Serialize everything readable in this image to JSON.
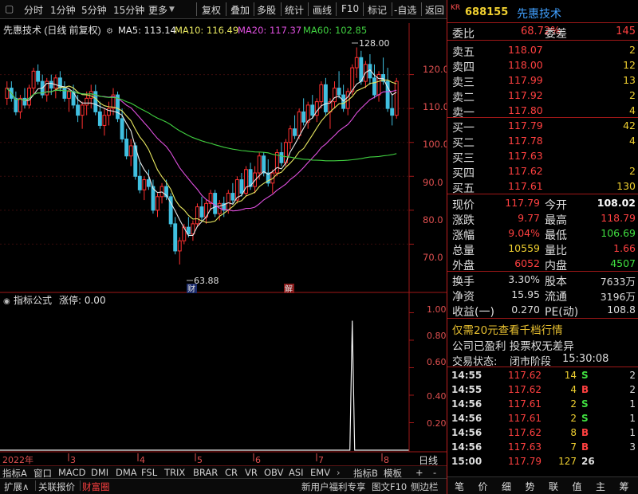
{
  "toolbar": {
    "periods": [
      "分时",
      "1分钟",
      "5分钟",
      "15分钟",
      "更多"
    ],
    "actions": [
      "复权",
      "叠加",
      "多股",
      "统计",
      "画线",
      "F10",
      "标记",
      "-自选",
      "返回"
    ]
  },
  "chart_header": {
    "title": "先惠技术 (日线 前复权)",
    "ma5": "MA5: 113.14",
    "ma10": "MA10: 116.49",
    "ma20": "MA20: 117.37",
    "ma60": "MA60: 102.85"
  },
  "colors": {
    "ma5": "#e8e8e8",
    "ma10": "#e8e860",
    "ma20": "#e050e0",
    "ma60": "#40d040",
    "up": "#ff3030",
    "down": "#40c0e0"
  },
  "price_axis": {
    "labels": [
      "120.0",
      "110.0",
      "100.0",
      "90.0",
      "80.0",
      "70.0"
    ]
  },
  "annotations": {
    "high": "128.00",
    "low": "63.88",
    "tag1": "财",
    "tag2": "解"
  },
  "indicator": {
    "title": "指标公式",
    "value": "涨停: 0.00",
    "labels": [
      "1.00",
      "0.80",
      "0.60",
      "0.40",
      "0.20"
    ]
  },
  "date_axis": {
    "labels": [
      "2022年",
      "3",
      "4",
      "5",
      "6",
      "7",
      "8"
    ],
    "right": "日线"
  },
  "indicator_tabs": [
    "指标A",
    "窗口",
    "MACD",
    "DMI",
    "DMA",
    "FSL",
    "TRIX",
    "BRAR",
    "CR",
    "VR",
    "OBV",
    "ASI",
    "EMV",
    "指标B",
    "模板",
    "+",
    "-"
  ],
  "bottom_tabs": [
    "扩展∧",
    "关联报价",
    "财富圈"
  ],
  "bottom_right": [
    "新用户福利专享",
    "图文F10",
    "侧边栏"
  ],
  "quote": {
    "code": "688155",
    "name": "先惠技术",
    "logo": "KR",
    "weibi_label": "委比",
    "weibi": "68.72%",
    "weicha_label": "委差",
    "weicha": "145",
    "asks": [
      {
        "label": "卖五",
        "price": "118.07",
        "vol": "2"
      },
      {
        "label": "卖四",
        "price": "118.00",
        "vol": "12"
      },
      {
        "label": "卖三",
        "price": "117.99",
        "vol": "13"
      },
      {
        "label": "卖二",
        "price": "117.92",
        "vol": "2"
      },
      {
        "label": "卖一",
        "price": "117.80",
        "vol": "4"
      }
    ],
    "bids": [
      {
        "label": "买一",
        "price": "117.79",
        "vol": "42"
      },
      {
        "label": "买二",
        "price": "117.78",
        "vol": "4"
      },
      {
        "label": "买三",
        "price": "117.63",
        "vol": ""
      },
      {
        "label": "买四",
        "price": "117.62",
        "vol": "2"
      },
      {
        "label": "买五",
        "price": "117.61",
        "vol": "130"
      }
    ],
    "stats": [
      {
        "l1": "现价",
        "v1": "117.79",
        "l2": "今开",
        "v2": "108.02"
      },
      {
        "l1": "涨跌",
        "v1": "9.77",
        "l2": "最高",
        "v2": "118.79"
      },
      {
        "l1": "涨幅",
        "v1": "9.04%",
        "l2": "最低",
        "v2": "106.69"
      },
      {
        "l1": "总量",
        "v1": "10559",
        "l2": "量比",
        "v2": "1.66"
      },
      {
        "l1": "外盘",
        "v1": "6052",
        "l2": "内盘",
        "v2": "4507"
      }
    ],
    "stats2": [
      {
        "l1": "换手",
        "v1": "3.30%",
        "l2": "股本",
        "v2": "7633万"
      },
      {
        "l1": "净资",
        "v1": "15.95",
        "l2": "流通",
        "v2": "3196万"
      },
      {
        "l1": "收益(一)",
        "v1": "0.270",
        "l2": "PE(动)",
        "v2": "108.8"
      }
    ],
    "promo": "仅需20元查看千档行情",
    "profit_line": "公司已盈利 投票权无差异",
    "status_label": "交易状态:",
    "status": "闭市阶段",
    "status_time": "15:30:08",
    "ticks": [
      {
        "t": "14:55",
        "p": "117.62",
        "v": "14",
        "d": "S"
      },
      {
        "t": "14:55",
        "p": "117.62",
        "v": "4",
        "d": "B"
      },
      {
        "t": "14:56",
        "p": "117.61",
        "v": "2",
        "d": "S"
      },
      {
        "t": "14:56",
        "p": "117.61",
        "v": "2",
        "d": "S"
      },
      {
        "t": "14:56",
        "p": "117.62",
        "v": "8",
        "d": "B"
      },
      {
        "t": "14:56",
        "p": "117.63",
        "v": "7",
        "d": "B"
      },
      {
        "t": "15:00",
        "p": "117.79",
        "v": "127",
        "d": "26"
      }
    ],
    "tick_counts": [
      "2",
      "2",
      "1",
      "1",
      "1",
      "3",
      ""
    ],
    "bottom_tabs": [
      "笔",
      "价",
      "细",
      "势",
      "联",
      "值",
      "主",
      "筹"
    ]
  },
  "chart_data": {
    "type": "candlestick",
    "ylim": [
      60,
      130
    ],
    "grid": true,
    "candles": [
      [
        113,
        118,
        111,
        116
      ],
      [
        116,
        118,
        112,
        113
      ],
      [
        113,
        115,
        108,
        109
      ],
      [
        109,
        114,
        107,
        113
      ],
      [
        113,
        116,
        110,
        111
      ],
      [
        111,
        117,
        110,
        116
      ],
      [
        116,
        122,
        114,
        121
      ],
      [
        121,
        123,
        117,
        118
      ],
      [
        118,
        120,
        113,
        114
      ],
      [
        114,
        119,
        112,
        118
      ],
      [
        118,
        120,
        114,
        116
      ],
      [
        116,
        120,
        113,
        119
      ],
      [
        119,
        121,
        115,
        116
      ],
      [
        116,
        118,
        112,
        113
      ],
      [
        113,
        116,
        109,
        115
      ],
      [
        115,
        117,
        110,
        111
      ],
      [
        111,
        114,
        106,
        108
      ],
      [
        108,
        112,
        104,
        111
      ],
      [
        111,
        115,
        108,
        113
      ],
      [
        113,
        117,
        110,
        115
      ],
      [
        115,
        117,
        108,
        109
      ],
      [
        109,
        112,
        104,
        105
      ],
      [
        105,
        110,
        102,
        108
      ],
      [
        108,
        112,
        105,
        110
      ],
      [
        110,
        116,
        108,
        114
      ],
      [
        114,
        115,
        106,
        107
      ],
      [
        107,
        110,
        100,
        101
      ],
      [
        101,
        104,
        95,
        96
      ],
      [
        96,
        101,
        93,
        99
      ],
      [
        99,
        100,
        89,
        90
      ],
      [
        90,
        94,
        85,
        86
      ],
      [
        86,
        90,
        83,
        89
      ],
      [
        89,
        92,
        86,
        87
      ],
      [
        87,
        89,
        79,
        80
      ],
      [
        80,
        85,
        78,
        84
      ],
      [
        84,
        88,
        82,
        87
      ],
      [
        87,
        89,
        83,
        84
      ],
      [
        84,
        85,
        75,
        76
      ],
      [
        76,
        78,
        67,
        68
      ],
      [
        68,
        72,
        64,
        71
      ],
      [
        71,
        76,
        70,
        75
      ],
      [
        75,
        78,
        72,
        73
      ],
      [
        73,
        77,
        71,
        76
      ],
      [
        76,
        82,
        75,
        81
      ],
      [
        81,
        84,
        77,
        78
      ],
      [
        78,
        83,
        76,
        82
      ],
      [
        82,
        86,
        80,
        85
      ],
      [
        85,
        86,
        78,
        79
      ],
      [
        79,
        83,
        77,
        82
      ],
      [
        82,
        84,
        78,
        80
      ],
      [
        80,
        86,
        79,
        85
      ],
      [
        85,
        88,
        82,
        83
      ],
      [
        83,
        90,
        82,
        89
      ],
      [
        89,
        91,
        84,
        85
      ],
      [
        85,
        93,
        84,
        92
      ],
      [
        92,
        94,
        86,
        87
      ],
      [
        87,
        93,
        85,
        91
      ],
      [
        91,
        97,
        89,
        96
      ],
      [
        96,
        97,
        90,
        91
      ],
      [
        91,
        95,
        87,
        88
      ],
      [
        88,
        92,
        85,
        91
      ],
      [
        91,
        98,
        90,
        97
      ],
      [
        97,
        100,
        93,
        94
      ],
      [
        94,
        101,
        93,
        100
      ],
      [
        100,
        105,
        98,
        104
      ],
      [
        104,
        108,
        101,
        102
      ],
      [
        102,
        110,
        101,
        109
      ],
      [
        109,
        113,
        105,
        106
      ],
      [
        106,
        112,
        104,
        111
      ],
      [
        111,
        114,
        107,
        108
      ],
      [
        108,
        113,
        106,
        112
      ],
      [
        112,
        118,
        110,
        117
      ],
      [
        117,
        119,
        108,
        109
      ],
      [
        109,
        113,
        104,
        112
      ],
      [
        112,
        118,
        110,
        116
      ],
      [
        116,
        121,
        113,
        114
      ],
      [
        114,
        117,
        109,
        110
      ],
      [
        110,
        116,
        108,
        115
      ],
      [
        115,
        123,
        114,
        122
      ],
      [
        122,
        128,
        119,
        125
      ],
      [
        125,
        127,
        117,
        118
      ],
      [
        118,
        124,
        116,
        123
      ],
      [
        123,
        126,
        117,
        119
      ],
      [
        119,
        123,
        113,
        114
      ],
      [
        114,
        121,
        112,
        120
      ],
      [
        120,
        125,
        117,
        118
      ],
      [
        118,
        122,
        109,
        110
      ],
      [
        110,
        114,
        105,
        108
      ],
      [
        108,
        119,
        107,
        118
      ]
    ],
    "ma_periods": {
      "ma5": 5,
      "ma10": 10,
      "ma20": 20,
      "ma60": 60
    },
    "limit_up_signal": {
      "index": 78,
      "value": 1.0
    }
  }
}
